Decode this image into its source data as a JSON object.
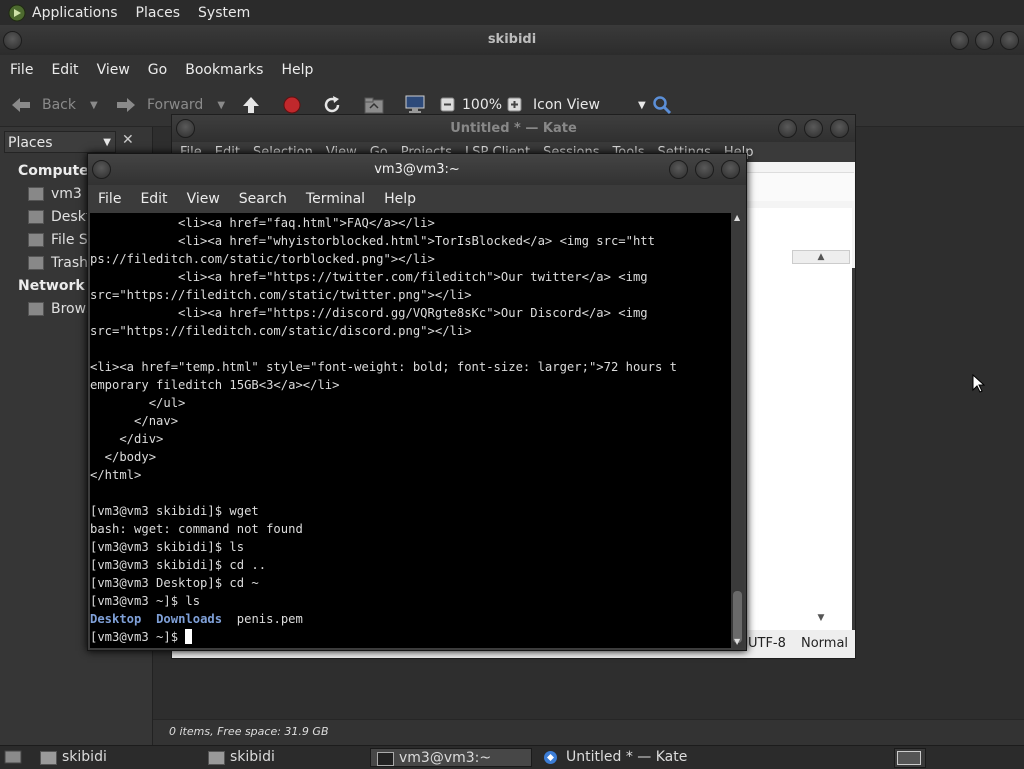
{
  "top_panel": {
    "applications": "Applications",
    "places": "Places",
    "system": "System"
  },
  "caja": {
    "title": "skibidi",
    "menu": [
      "File",
      "Edit",
      "View",
      "Go",
      "Bookmarks",
      "Help"
    ],
    "toolbar": {
      "back": "Back",
      "forward": "Forward",
      "zoom": "100%",
      "view_mode": "Icon View"
    },
    "sidebar": {
      "selector": "Places",
      "close": "✕",
      "computer": "Computer",
      "items": [
        "vm3",
        "Deskt",
        "File Sy",
        "Trash"
      ],
      "network": "Network",
      "network_items": [
        "Brows"
      ]
    },
    "status": "0 items, Free space: 31.9 GB"
  },
  "kate": {
    "title": "Untitled * — Kate",
    "menu": [
      "File",
      "Edit",
      "Selection",
      "View",
      "Go",
      "Projects",
      "LSP Client",
      "Sessions",
      "Tools",
      "Settings",
      "Help"
    ],
    "status": {
      "encoding": "UTF-8",
      "mode": "Normal"
    }
  },
  "terminal": {
    "title": "vm3@vm3:~",
    "menu": [
      "File",
      "Edit",
      "View",
      "Search",
      "Terminal",
      "Help"
    ],
    "lines": [
      "            <li><a href=\"faq.html\">FAQ</a></li>",
      "            <li><a href=\"whyistorblocked.html\">TorIsBlocked</a> <img src=\"htt",
      "ps://fileditch.com/static/torblocked.png\"></li>",
      "            <li><a href=\"https://twitter.com/fileditch\">Our twitter</a> <img",
      "src=\"https://fileditch.com/static/twitter.png\"></li>",
      "            <li><a href=\"https://discord.gg/VQRgte8sKc\">Our Discord</a> <img",
      "src=\"https://fileditch.com/static/discord.png\"></li>",
      "",
      "<li><a href=\"temp.html\" style=\"font-weight: bold; font-size: larger;\">72 hours t",
      "emporary fileditch 15GB<3</a></li>",
      "        </ul>",
      "      </nav>",
      "    </div>",
      "  </body>",
      "</html>",
      "",
      "[vm3@vm3 skibidi]$ wget",
      "bash: wget: command not found",
      "[vm3@vm3 skibidi]$ ls",
      "[vm3@vm3 skibidi]$ cd ..",
      "[vm3@vm3 Desktop]$ cd ~",
      "[vm3@vm3 ~]$ ls"
    ],
    "ls_dirs": [
      "Desktop",
      "Downloads"
    ],
    "ls_file": "penis.pem",
    "prompt": "[vm3@vm3 ~]$ "
  },
  "taskbar": {
    "tasks": [
      "skibidi",
      "skibidi",
      "vm3@vm3:~",
      "Untitled * — Kate"
    ]
  }
}
